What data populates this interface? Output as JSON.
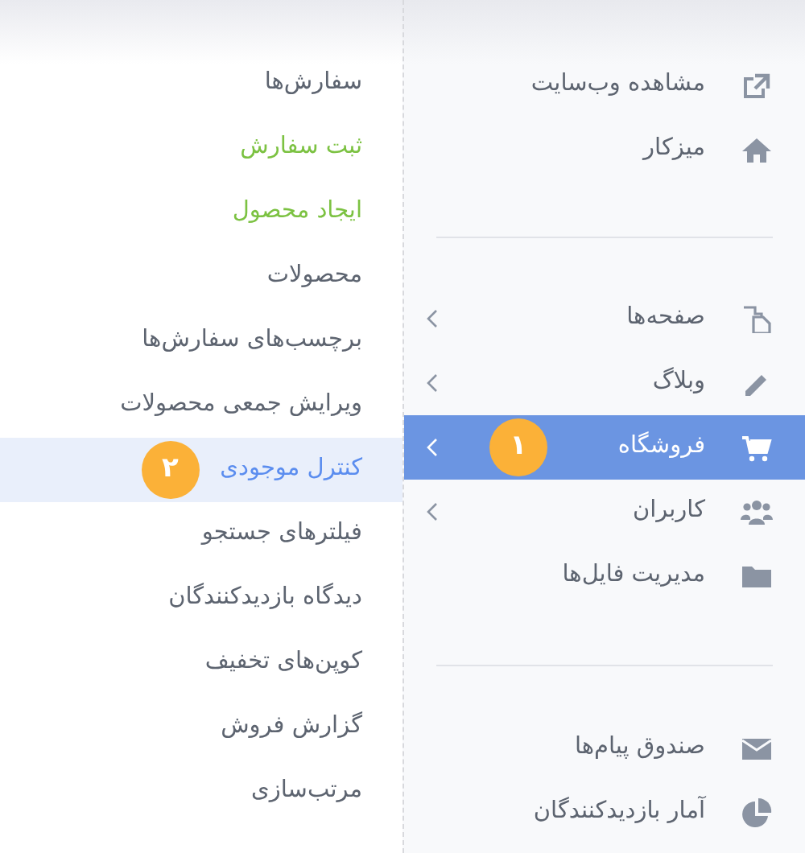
{
  "main_menu": {
    "groups": [
      {
        "items": [
          {
            "label": "مشاهده وب‌سایت",
            "has_submenu": false,
            "selected": false
          },
          {
            "label": "میزکار",
            "has_submenu": false,
            "selected": false
          }
        ]
      },
      {
        "items": [
          {
            "label": "صفحه‌ها",
            "has_submenu": true,
            "selected": false
          },
          {
            "label": "وبلاگ",
            "has_submenu": true,
            "selected": false
          },
          {
            "label": "فروشگاه",
            "has_submenu": true,
            "selected": true,
            "badge": "١"
          },
          {
            "label": "کاربران",
            "has_submenu": true,
            "selected": false
          },
          {
            "label": "مدیریت فایل‌ها",
            "has_submenu": false,
            "selected": false
          }
        ]
      },
      {
        "items": [
          {
            "label": "صندوق پیام‌ها",
            "has_submenu": false,
            "selected": false
          },
          {
            "label": "آمار بازدیدکنندگان",
            "has_submenu": false,
            "selected": false
          }
        ]
      }
    ]
  },
  "submenu": {
    "items": [
      {
        "label": "سفارش‌ها",
        "kind": "link",
        "selected": false
      },
      {
        "label": "ثبت سفارش",
        "kind": "action",
        "selected": false
      },
      {
        "label": "ایجاد محصول",
        "kind": "action",
        "selected": false
      },
      {
        "label": "محصولات",
        "kind": "link",
        "selected": false
      },
      {
        "label": "برچسب‌های سفارش‌ها",
        "kind": "link",
        "selected": false
      },
      {
        "label": "ویرایش جمعی محصولات",
        "kind": "link",
        "selected": false
      },
      {
        "label": "کنترل موجودی",
        "kind": "link",
        "selected": true,
        "badge": "٢"
      },
      {
        "label": "فیلترهای جستجو",
        "kind": "link",
        "selected": false
      },
      {
        "label": "دیدگاه بازدیدکنندگان",
        "kind": "link",
        "selected": false
      },
      {
        "label": "کوپن‌های تخفیف",
        "kind": "link",
        "selected": false
      },
      {
        "label": "گزارش فروش",
        "kind": "link",
        "selected": false
      },
      {
        "label": "مرتب‌سازی",
        "kind": "link",
        "selected": false
      }
    ]
  }
}
